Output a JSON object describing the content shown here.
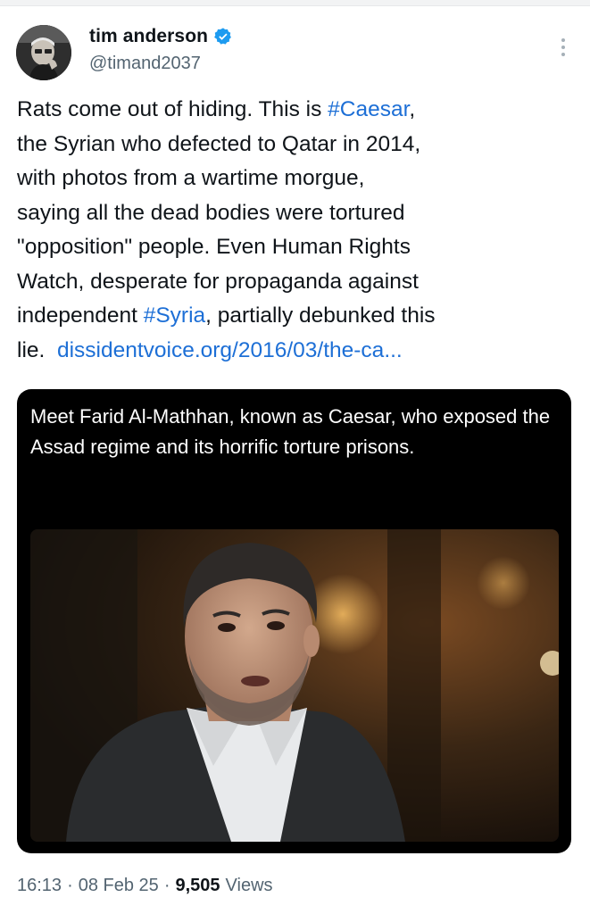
{
  "author": {
    "name": "tim anderson",
    "handle": "@timand2037",
    "verified": true
  },
  "tweet": {
    "segments": [
      {
        "text": "Rats come out of hiding. This is ",
        "link": false
      },
      {
        "text": "#Caesar",
        "link": true
      },
      {
        "text": ",\nthe Syrian who defected to Qatar in 2014,\nwith photos from a wartime morgue,\nsaying all the dead bodies were tortured\n\"opposition\" people. Even Human Rights\nWatch, desperate for propaganda against\nindependent ",
        "link": false
      },
      {
        "text": "#Syria",
        "link": true
      },
      {
        "text": ", partially debunked this\nlie.  ",
        "link": false
      },
      {
        "text": "dissidentvoice.org/2016/03/the-ca...",
        "link": true
      }
    ]
  },
  "media": {
    "caption": "Meet Farid Al-Mathhan, known as Caesar, who exposed the Assad regime and its horrific torture prisons."
  },
  "meta": {
    "time": "16:13",
    "date": "08 Feb 25",
    "views_count": "9,505",
    "views_label": "Views"
  },
  "colors": {
    "link": "#1d6fd6",
    "verified": "#1d9bf0",
    "secondary_text": "#536471"
  },
  "icons": [
    "verified-badge-icon",
    "more-options-icon"
  ]
}
